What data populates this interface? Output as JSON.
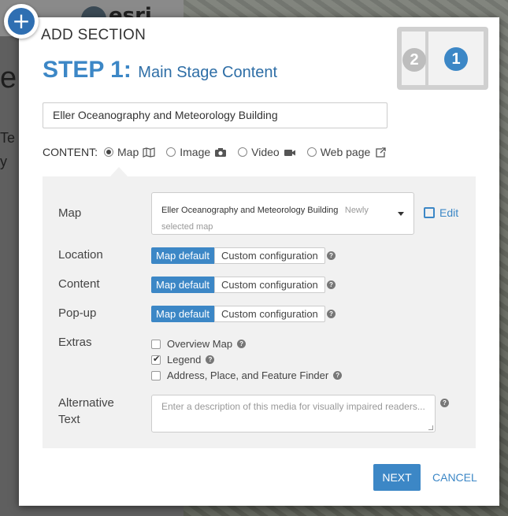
{
  "background": {
    "logo_text": "esri",
    "frag_e": "e",
    "frag_te": "Te",
    "frag_y": "y"
  },
  "dialog": {
    "add_icon": "+",
    "title": "ADD SECTION",
    "step_number": "STEP 1:",
    "step_subtitle": "Main Stage Content",
    "layout_thumb": {
      "left_num": "2",
      "right_num": "1"
    },
    "section_title_value": "Eller Oceanography and Meteorology Building",
    "content": {
      "label": "CONTENT:",
      "options": [
        {
          "label": "Map",
          "icon": "map-icon",
          "selected": true
        },
        {
          "label": "Image",
          "icon": "camera-icon",
          "selected": false
        },
        {
          "label": "Video",
          "icon": "video-icon",
          "selected": false
        },
        {
          "label": "Web page",
          "icon": "external-link-icon",
          "selected": false
        }
      ]
    },
    "panel": {
      "map_label": "Map",
      "map_selected": "Eller Oceanography and Meteorology Building",
      "map_hint": "Newly selected map",
      "edit_label": "Edit",
      "location_label": "Location",
      "content_label": "Content",
      "popup_label": "Pop-up",
      "toggle_default": "Map default",
      "toggle_custom": "Custom configuration",
      "extras_label": "Extras",
      "extras": [
        {
          "label": "Overview Map",
          "checked": false
        },
        {
          "label": "Legend",
          "checked": true
        },
        {
          "label": "Address, Place, and Feature Finder",
          "checked": false
        }
      ],
      "alt_label_1": "Alternative",
      "alt_label_2": "Text",
      "alt_placeholder": "Enter a description of this media for visually impaired readers..."
    },
    "next_label": "NEXT",
    "cancel_label": "CANCEL"
  },
  "colors": {
    "accent": "#3c87c6",
    "panel_bg": "#f1f1f1"
  }
}
